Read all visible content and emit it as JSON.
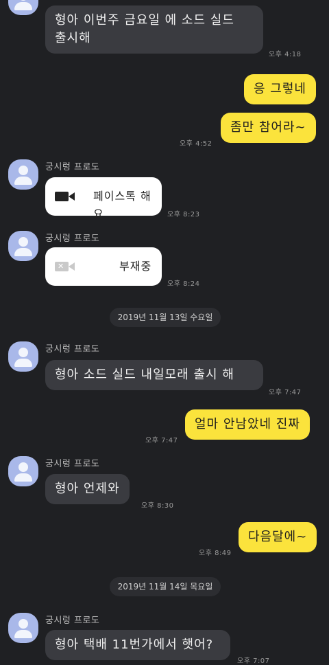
{
  "contact": {
    "name": "궁시렁 프로도"
  },
  "messages": {
    "m1": {
      "text": "형아 이번주 금요일 에 소드 실드\n출시해",
      "time": "오후 4:18"
    },
    "m2": {
      "text": "응 그렇네",
      "time": ""
    },
    "m3": {
      "text": "좀만 참어라~",
      "time": "오후 4:52"
    },
    "m4": {
      "text": "페이스톡 해요",
      "time": "오후 8:23"
    },
    "m5": {
      "text": "부재중",
      "time": "오후 8:24"
    },
    "m6": {
      "text": "형아 소드 실드 내일모래 출시 해",
      "time": "오후 7:47"
    },
    "m7": {
      "text": "얼마 안남았네 진짜",
      "time": "오후 7:47"
    },
    "m8": {
      "text": "형아 언제와",
      "time": "오후 8:30"
    },
    "m9": {
      "text": "다음달에~",
      "time": "오후 8:49"
    },
    "m10": {
      "text": "형아 택배 11번가에서 햇어?",
      "time": "오후 7:07"
    }
  },
  "dates": {
    "d1": "2019년 11월 13일 수요일",
    "d2": "2019년 11월 14일 목요일"
  },
  "colors": {
    "background": "#1f2023",
    "incoming_bubble": "#3a3b40",
    "outgoing_bubble": "#fbe33c",
    "avatar": "#a9b8e9"
  },
  "icons": {
    "video_call": "video-camera-icon",
    "missed_call": "video-camera-off-icon",
    "avatar": "default-profile-icon"
  }
}
